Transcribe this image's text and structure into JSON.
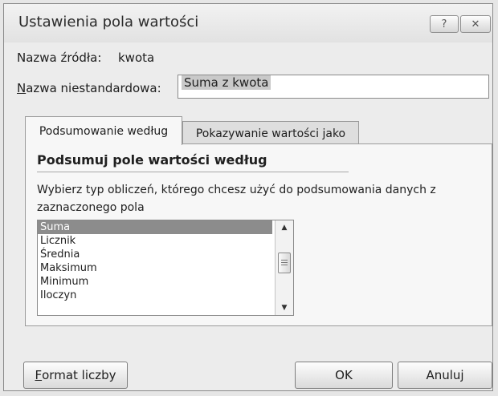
{
  "window": {
    "title": "Ustawienia pola wartości"
  },
  "titlebar": {
    "help_label": "?",
    "close_label": "✕"
  },
  "source": {
    "label": "Nazwa źródła:",
    "value": "kwota"
  },
  "custom_name": {
    "label_first": "N",
    "label_rest": "azwa niestandardowa:",
    "value": "Suma z kwota"
  },
  "tabs": [
    {
      "label": "Podsumowanie według"
    },
    {
      "label": "Pokazywanie wartości jako"
    }
  ],
  "summary": {
    "heading": "Podsumuj pole wartości według",
    "description": "Wybierz typ obliczeń, którego chcesz użyć do podsumowania danych z zaznaczonego pola",
    "items": [
      "Suma",
      "Licznik",
      "Średnia",
      "Maksimum",
      "Minimum",
      "Iloczyn"
    ],
    "selected": "Suma"
  },
  "buttons": {
    "format_first": "F",
    "format_rest": "ormat liczby",
    "ok": "OK",
    "cancel": "Anuluj"
  }
}
